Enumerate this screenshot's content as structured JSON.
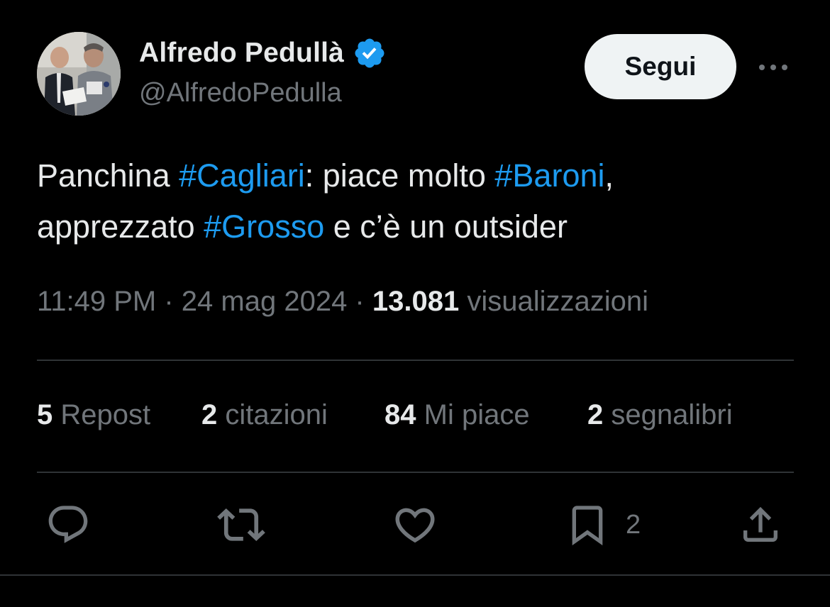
{
  "author": {
    "display_name": "Alfredo Pedullà",
    "handle": "@AlfredoPedulla",
    "verified": true,
    "verified_color": "#1d9bf0"
  },
  "follow_button": {
    "label": "Segui"
  },
  "more_button": {
    "icon": "more-horizontal-icon"
  },
  "tweet": {
    "segments": [
      {
        "text": "Panchina ",
        "hashtag": false
      },
      {
        "text": "#Cagliari",
        "hashtag": true
      },
      {
        "text": ": piace molto ",
        "hashtag": false
      },
      {
        "text": "#Baroni",
        "hashtag": true
      },
      {
        "text": ",",
        "hashtag": false
      },
      {
        "text": "apprezzato ",
        "hashtag": false
      },
      {
        "text": "#Grosso",
        "hashtag": true
      },
      {
        "text": " e c’è un outsider",
        "hashtag": false
      }
    ],
    "hashtag_color": "#1d9bf0"
  },
  "meta": {
    "time": "11:49 PM",
    "separator": " · ",
    "date": "24 mag 2024",
    "views_count": "13.081",
    "views_label": "visualizzazioni"
  },
  "stats": [
    {
      "count": "5",
      "label": "Repost"
    },
    {
      "count": "2",
      "label": "citazioni"
    },
    {
      "count": "84",
      "label": "Mi piace"
    },
    {
      "count": "2",
      "label": "segnalibri"
    }
  ],
  "actions": {
    "reply_icon": "reply-icon",
    "repost_icon": "repost-icon",
    "like_icon": "heart-icon",
    "bookmark_icon": "bookmark-icon",
    "bookmark_count": "2",
    "share_icon": "share-icon"
  }
}
